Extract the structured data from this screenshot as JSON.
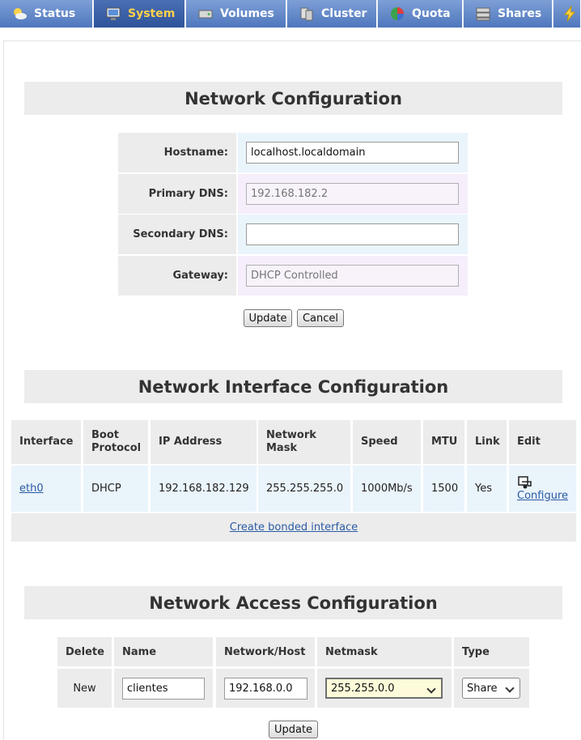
{
  "nav": {
    "tabs": [
      {
        "label": "Status",
        "icon": "weather-sun-icon"
      },
      {
        "label": "System",
        "icon": "monitor-icon",
        "active": true
      },
      {
        "label": "Volumes",
        "icon": "drive-icon"
      },
      {
        "label": "Cluster",
        "icon": "cluster-icon"
      },
      {
        "label": "Quota",
        "icon": "quota-pie-icon"
      },
      {
        "label": "Shares",
        "icon": "server-icon"
      },
      {
        "label": "",
        "icon": "lightning-icon"
      }
    ]
  },
  "network_config": {
    "title": "Network Configuration",
    "fields": [
      {
        "label": "Hostname:",
        "value": "localhost.localdomain",
        "placeholder": "",
        "disabled": false
      },
      {
        "label": "Primary DNS:",
        "value": "",
        "placeholder": "192.168.182.2",
        "disabled": true
      },
      {
        "label": "Secondary DNS:",
        "value": "",
        "placeholder": "",
        "disabled": false
      },
      {
        "label": "Gateway:",
        "value": "",
        "placeholder": "DHCP Controlled",
        "disabled": true
      }
    ],
    "update_label": "Update",
    "cancel_label": "Cancel"
  },
  "interface_config": {
    "title": "Network Interface Configuration",
    "headers": [
      "Interface",
      "Boot Protocol",
      "IP Address",
      "Network Mask",
      "Speed",
      "MTU",
      "Link",
      "Edit"
    ],
    "rows": [
      {
        "interface": "eth0",
        "boot_protocol": "DHCP",
        "ip": "192.168.182.129",
        "mask": "255.255.255.0",
        "speed": "1000Mb/s",
        "mtu": "1500",
        "link": "Yes",
        "edit_label": "Configure"
      }
    ],
    "bond_link": "Create bonded interface"
  },
  "access_config": {
    "title": "Network Access Configuration",
    "headers": [
      "Delete",
      "Name",
      "Network/Host",
      "Netmask",
      "Type"
    ],
    "new_label": "New",
    "name_value": "clientes",
    "network_value": "192.168.0.0",
    "netmask_value": "255.255.0.0",
    "type_value": "Share",
    "update_label": "Update"
  }
}
